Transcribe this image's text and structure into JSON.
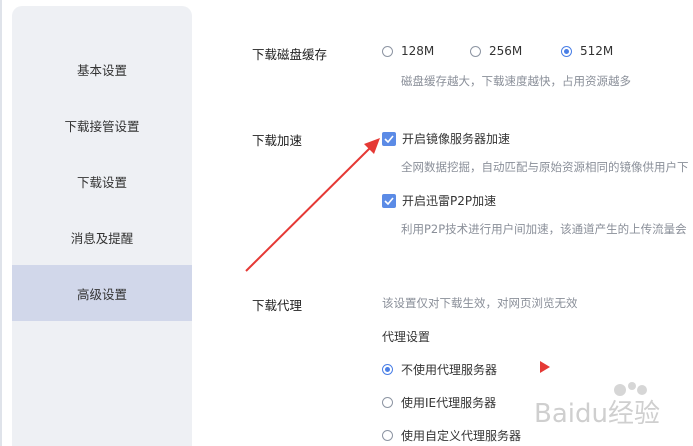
{
  "sidebar": {
    "items": [
      {
        "label": "基本设置"
      },
      {
        "label": "下载接管设置"
      },
      {
        "label": "下载设置"
      },
      {
        "label": "消息及提醒"
      },
      {
        "label": "高级设置",
        "active": true
      }
    ]
  },
  "disk_cache": {
    "title": "下载磁盘缓存",
    "options": [
      "128M",
      "256M",
      "512M"
    ],
    "selected": "512M",
    "hint": "磁盘缓存越大，下载速度越快，占用资源越多"
  },
  "acceleration": {
    "title": "下载加速",
    "mirror": {
      "label": "开启镜像服务器加速",
      "checked": true,
      "hint": "全网数据挖掘，自动匹配与原始资源相同的镜像供用户下"
    },
    "p2p": {
      "label": "开启迅雷P2P加速",
      "checked": true,
      "hint": "利用P2P技术进行用户间加速，该通道产生的上传流量会"
    }
  },
  "proxy": {
    "title": "下载代理",
    "hint": "该设置仅对下载生效，对网页浏览无效",
    "subtitle": "代理设置",
    "options": [
      "不使用代理服务器",
      "使用IE代理服务器",
      "使用自定义代理服务器"
    ],
    "selected": "不使用代理服务器"
  },
  "colors": {
    "accent": "#4a7fe6",
    "annotation": "#e53935",
    "sidebar_active": "#d1d7ea"
  },
  "watermark": {
    "text": "Baidu经验"
  }
}
